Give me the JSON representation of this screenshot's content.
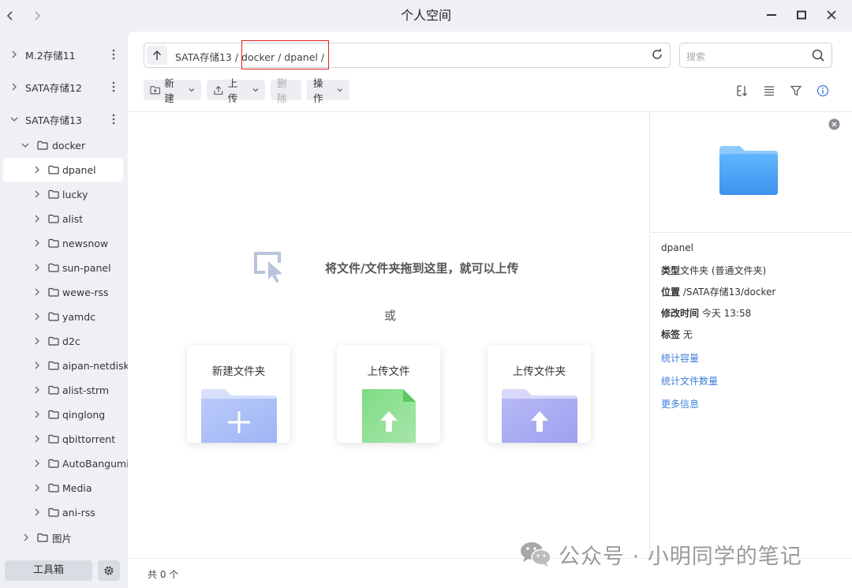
{
  "window": {
    "title": "个人空间"
  },
  "sidebar": {
    "drives": [
      {
        "label": "M.2存储11"
      },
      {
        "label": "SATA存储12"
      },
      {
        "label": "SATA存储13"
      }
    ],
    "root_folder": "docker",
    "folders": [
      "dpanel",
      "lucky",
      "alist",
      "newsnow",
      "sun-panel",
      "wewe-rss",
      "yamdc",
      "d2c",
      "aipan-netdisk",
      "alist-strm",
      "qinglong",
      "qbittorrent",
      "AutoBangumi",
      "Media",
      "ani-rss"
    ],
    "sibling_folder": "图片",
    "toolbox_label": "工具箱"
  },
  "pathbar": {
    "path": "SATA存储13 / docker / dpanel /"
  },
  "search": {
    "placeholder": "搜索"
  },
  "toolbar": {
    "new_label": "新建",
    "upload_label": "上传",
    "delete_label": "删除",
    "actions_label": "操作"
  },
  "dropzone": {
    "hint": "将文件/文件夹拖到这里，就可以上传",
    "or": "或",
    "cards": [
      {
        "label": "新建文件夹"
      },
      {
        "label": "上传文件"
      },
      {
        "label": "上传文件夹"
      }
    ]
  },
  "info": {
    "name": "dpanel",
    "type_key": "类型",
    "type_val": "文件夹 (普通文件夹)",
    "loc_key": "位置",
    "loc_val": " /SATA存储13/docker",
    "mtime_key": "修改时间",
    "mtime_val": " 今天 13:58",
    "tag_key": "标签",
    "tag_val": " 无",
    "link_capacity": "统计容量",
    "link_count": "统计文件数量",
    "link_more": "更多信息"
  },
  "footer": {
    "count": "共 0 个"
  },
  "watermark": {
    "text": "公众号 · 小明同学的笔记"
  },
  "colors": {
    "accent": "#3b7ddd",
    "highlight_box": "#e02020",
    "folder_blue": "#4aa3f5"
  }
}
